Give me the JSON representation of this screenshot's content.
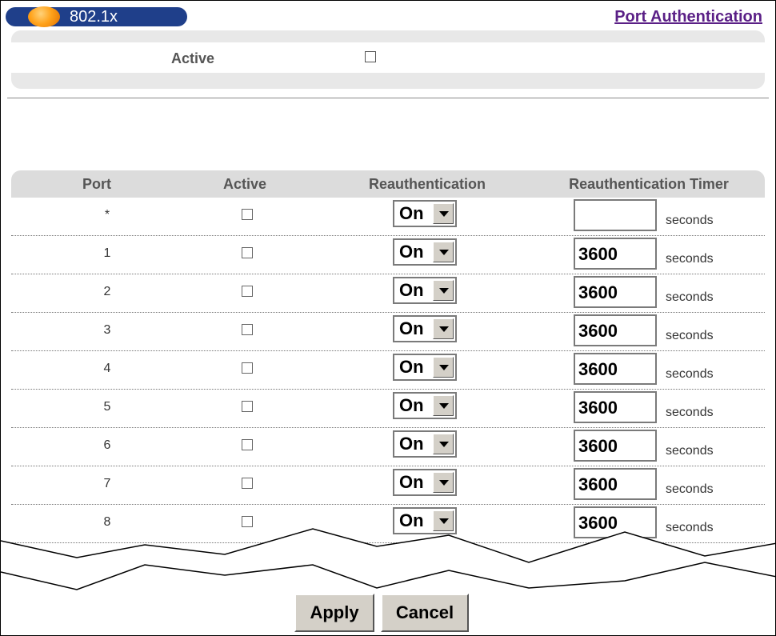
{
  "header": {
    "title": "802.1x",
    "link": "Port Authentication"
  },
  "global": {
    "active_label": "Active",
    "active_checked": false
  },
  "table": {
    "columns": [
      "Port",
      "Active",
      "Reauthentication",
      "Reauthentication Timer"
    ],
    "unit": "seconds",
    "rows": [
      {
        "port": "*",
        "active": false,
        "reauth": "On",
        "timer": ""
      },
      {
        "port": "1",
        "active": false,
        "reauth": "On",
        "timer": "3600"
      },
      {
        "port": "2",
        "active": false,
        "reauth": "On",
        "timer": "3600"
      },
      {
        "port": "3",
        "active": false,
        "reauth": "On",
        "timer": "3600"
      },
      {
        "port": "4",
        "active": false,
        "reauth": "On",
        "timer": "3600"
      },
      {
        "port": "5",
        "active": false,
        "reauth": "On",
        "timer": "3600"
      },
      {
        "port": "6",
        "active": false,
        "reauth": "On",
        "timer": "3600"
      },
      {
        "port": "7",
        "active": false,
        "reauth": "On",
        "timer": "3600"
      },
      {
        "port": "8",
        "active": false,
        "reauth": "On",
        "timer": "3600"
      }
    ]
  },
  "actions": {
    "apply": "Apply",
    "cancel": "Cancel"
  },
  "colors": {
    "title_bar": "#1f3f8a",
    "link": "#5a1f86",
    "panel": "#e8e8e8"
  }
}
